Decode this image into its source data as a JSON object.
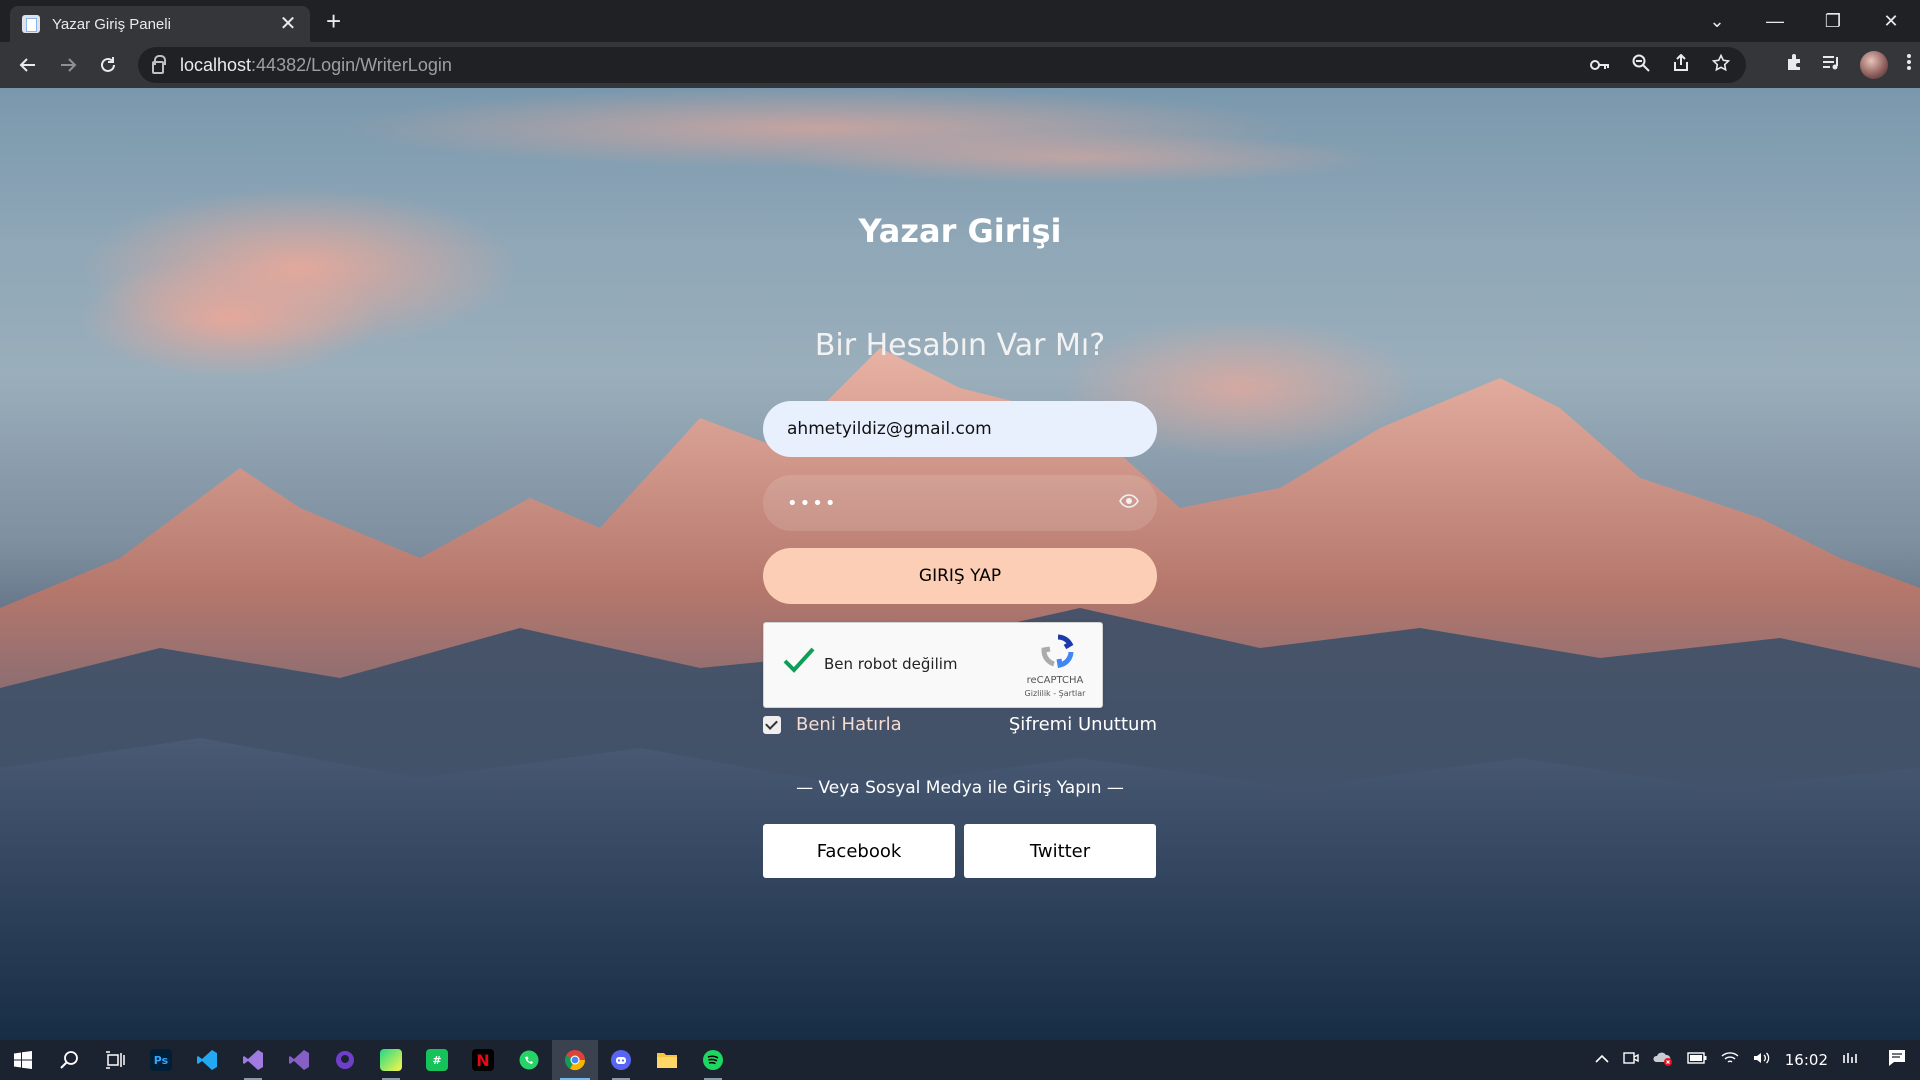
{
  "browser": {
    "tab_title": "Yazar Giriş Paneli",
    "tab_close": "✕",
    "new_tab": "+",
    "url_host": "localhost",
    "url_path": ":44382/Login/WriterLogin",
    "window_controls": {
      "chevron": "⌄",
      "minimize": "—",
      "restore": "❐",
      "close": "✕"
    }
  },
  "page": {
    "title": "Yazar Girişi",
    "subtitle": "Bir Hesabın Var Mı?",
    "email_value": "ahmetyildiz@gmail.com",
    "password_value": "1234",
    "submit_label": "GIRIŞ YAP",
    "recaptcha": {
      "label": "Ben robot değilim",
      "brand": "reCAPTCHA",
      "links": "Gizlilik - Şartlar",
      "checked": true
    },
    "remember_label": "Beni Hatırla",
    "remember_checked": true,
    "forgot_label": "Şifremi Unuttum",
    "social_divider": "— Veya Sosyal Medya ile Giriş Yapın —",
    "facebook_label": "Facebook",
    "twitter_label": "Twitter"
  },
  "taskbar": {
    "apps": [
      "start-icon",
      "search-icon",
      "task-view-icon",
      "photoshop-icon",
      "vscode-icon",
      "visual-studio-icon",
      "visual-studio-code-purple-icon",
      "github-desktop-icon",
      "pycharm-icon",
      "numbers-icon",
      "netflix-icon",
      "whatsapp-icon",
      "chrome-icon",
      "discord-icon",
      "file-explorer-icon",
      "spotify-icon"
    ],
    "photoshop_text": "Ps",
    "clock": "16:02"
  },
  "colors": {
    "submit_bg": "#fbceb5",
    "email_bg": "#e8f0fe",
    "chrome_bg": "#202124",
    "taskbar_bg": "#1b2230"
  }
}
